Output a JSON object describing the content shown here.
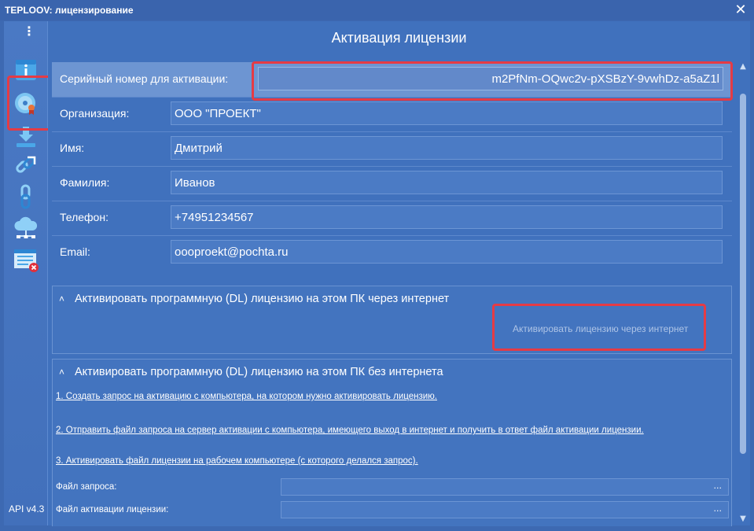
{
  "window": {
    "title": "TEPLOOV: лицензирование",
    "close_symbol": "✕"
  },
  "sidebar": {
    "menu_symbol": "⋮",
    "items": [
      {
        "icon": "info-icon"
      },
      {
        "icon": "license-disc-icon"
      },
      {
        "icon": "download-icon"
      },
      {
        "icon": "link-icon"
      },
      {
        "icon": "chain-icon"
      },
      {
        "icon": "cloud-network-icon"
      },
      {
        "icon": "list-remove-icon"
      }
    ],
    "version": "API v4.3"
  },
  "header": {
    "title": "Активация лицензии"
  },
  "form": {
    "serial": {
      "label": "Серийный номер для активации:",
      "value": "m2PfNm-OQwc2v-pXSBzY-9vwhDz-a5aZ1l"
    },
    "organization": {
      "label": "Организация:",
      "value": "ООО \"ПРОЕКТ\""
    },
    "name": {
      "label": "Имя:",
      "value": "Дмитрий"
    },
    "surname": {
      "label": "Фамилия:",
      "value": "Иванов"
    },
    "phone": {
      "label": "Телефон:",
      "value": "+74951234567"
    },
    "email": {
      "label": "Email:",
      "value": "oooproekt@pochta.ru"
    }
  },
  "online_group": {
    "chevron": "˄",
    "title": "Активировать программную (DL) лицензию на этом ПК через интернет",
    "button": "Активировать лицензию через интернет"
  },
  "offline_group": {
    "chevron": "˄",
    "title": "Активировать программную (DL) лицензию на этом ПК без интернета",
    "step1": "1. Создать запрос на активацию с компьютера, на котором нужно активировать лицензию.",
    "step2": "2. Отправить файл запроса на сервер активации с компьютера, имеющего выход в интернет и получить в ответ файл активации лицензии.",
    "step3": "3. Активировать файл лицензии на рабочем компьютере (с которого делался запрос).",
    "request_file_label": "Файл запроса:",
    "activation_file_label": "Файл активации лицензии:",
    "browse": "..."
  },
  "scrollbar": {
    "up": "▲",
    "down": "▼"
  }
}
